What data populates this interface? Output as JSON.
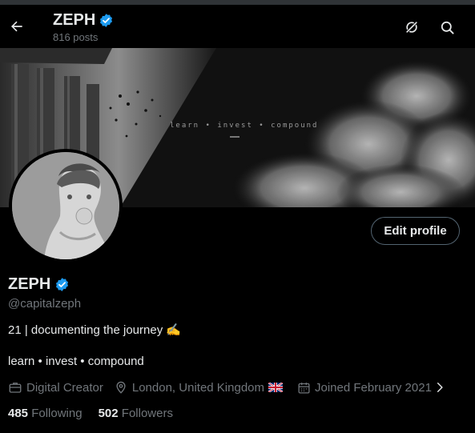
{
  "header": {
    "name": "ZEPH",
    "posts": "816 posts",
    "back_icon": "arrow-left-icon",
    "grok_icon": "grok-icon",
    "search_icon": "search-icon"
  },
  "banner": {
    "tagline": "learn • invest • compound"
  },
  "profile": {
    "edit_label": "Edit profile",
    "name": "ZEPH",
    "handle": "@capitalzeph",
    "bio_line1": "21 | documenting the journey ✍️",
    "bio_line2": "learn • invest • compound",
    "category": "Digital Creator",
    "location": "London, United Kingdom",
    "joined": "Joined February 2021",
    "following_count": "485",
    "following_label": "Following",
    "followers_count": "502",
    "followers_label": "Followers"
  },
  "colors": {
    "background": "#000000",
    "text": "#e7e9ea",
    "muted": "#71767b",
    "verified": "#1d9bf0",
    "button_border": "#536471"
  }
}
